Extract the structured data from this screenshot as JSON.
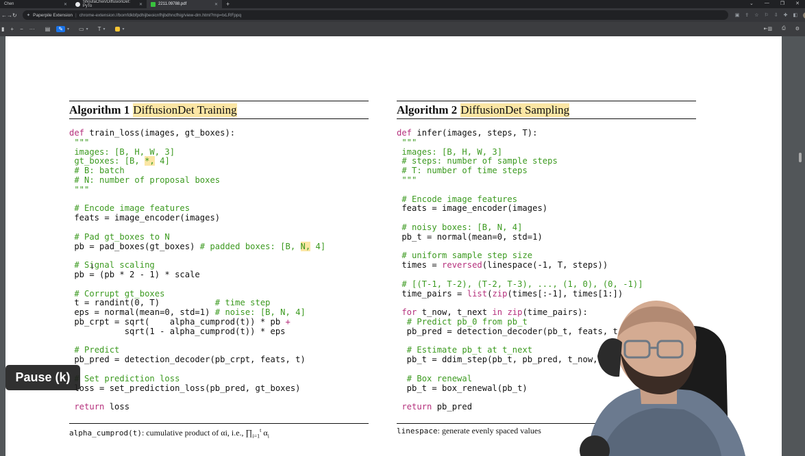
{
  "browser": {
    "tabs": [
      {
        "label": "Chen",
        "active": false
      },
      {
        "label": "ShoufaChen/DiffusionDet: PyTo",
        "active": false
      },
      {
        "label": "2211.09788.pdf",
        "active": true
      }
    ],
    "new_tab_symbol": "+",
    "address": {
      "extension_name": "Paperpile Extension",
      "url": "chrome-extension://bomfdkbfpdhijbeoicnfhjbdhncfhig/view-dm.html?mp=txLRFppq"
    }
  },
  "pdf_toolbar": {
    "zoom_in": "+",
    "zoom_out": "−",
    "more": "···",
    "text_tool": "T"
  },
  "algo1": {
    "number": "Algorithm 1",
    "title": "DiffusionDet Training",
    "footnote_code": "alpha_cumprod(t)",
    "footnote_text": ": cumulative product of α",
    "footnote_tail": "i, i.e., ∏",
    "footnote_end": " α"
  },
  "algo2": {
    "number": "Algorithm 2",
    "title": "DiffusionDet Sampling",
    "footnote_code": "linespace",
    "footnote_text": ": generate evenly spaced values"
  },
  "overlay": {
    "pause_label": "Pause (k)"
  },
  "colors": {
    "keyword": "#b5307c",
    "comment": "#3c9a20",
    "highlight": "#fbe6a4"
  }
}
